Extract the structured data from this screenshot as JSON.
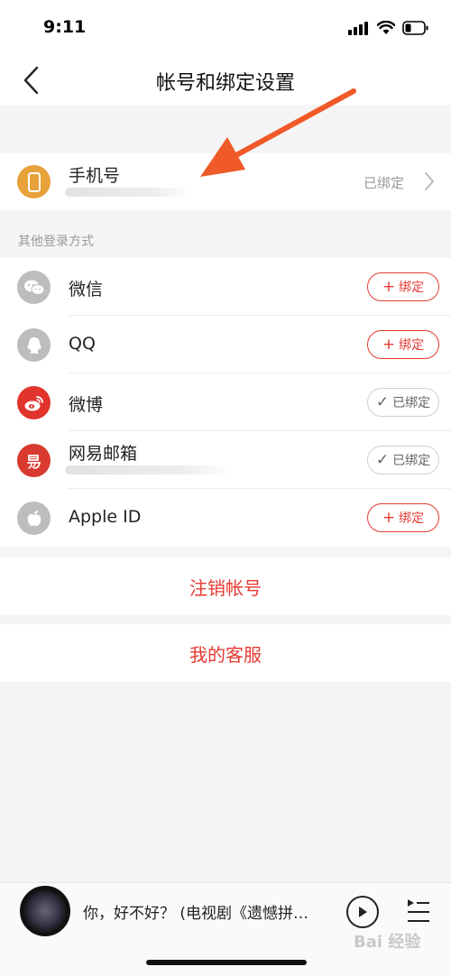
{
  "status_bar": {
    "time": "9:11"
  },
  "nav": {
    "title": "帐号和绑定设置"
  },
  "phone": {
    "label": "手机号",
    "status": "已绑定"
  },
  "section_title": "其他登录方式",
  "accounts": [
    {
      "label": "微信",
      "action": "绑定",
      "state": "unbound",
      "icon": "wechat-icon",
      "color": "#bdbdbd"
    },
    {
      "label": "QQ",
      "action": "绑定",
      "state": "unbound",
      "icon": "qq-icon",
      "color": "#bdbdbd"
    },
    {
      "label": "微博",
      "action": "已绑定",
      "state": "bound",
      "icon": "weibo-icon",
      "color": "#e0342c"
    },
    {
      "label": "网易邮箱",
      "action": "已绑定",
      "state": "bound",
      "icon": "netease-mail-icon",
      "color": "#d83a2f"
    },
    {
      "label": "Apple ID",
      "action": "绑定",
      "state": "unbound",
      "icon": "apple-icon",
      "color": "#bdbdbd"
    }
  ],
  "actions": {
    "cancel_account": "注销帐号",
    "customer_service": "我的客服"
  },
  "player": {
    "song": "你，好不好？ (电视剧《遗憾拼…"
  },
  "watermark": "Bai 经验",
  "colors": {
    "accent": "#e53a33",
    "phone_icon": "#e8a23b",
    "arrow": "#f05a28"
  }
}
